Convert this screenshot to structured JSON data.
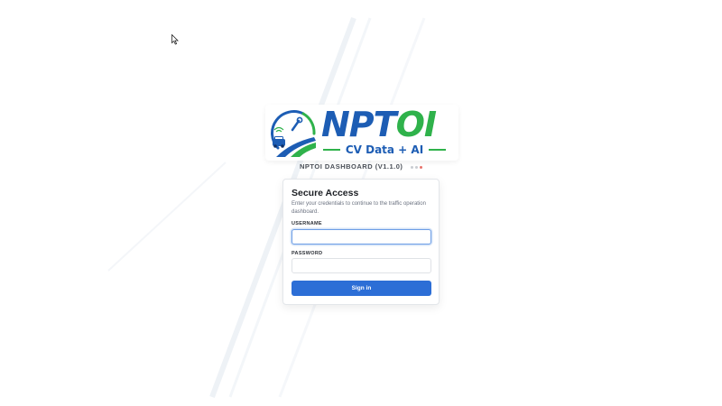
{
  "logo": {
    "name_part_a": "NPT",
    "name_part_b": "OI",
    "tagline": "CV Data + AI",
    "colors": {
      "blue": "#1d5db4",
      "green": "#2fb24b"
    }
  },
  "header": {
    "version_label": "NPTOI DASHBOARD (V1.1.0)",
    "status_dot_colors": [
      "#c9ccd1",
      "#c9ccd1",
      "#e8736b"
    ]
  },
  "login": {
    "title": "Secure Access",
    "subtitle": "Enter your credentials to continue to the traffic operation dashboard.",
    "username_label": "USERNAME",
    "username_value": "",
    "password_label": "PASSWORD",
    "password_value": "",
    "signin_label": "Sign in"
  },
  "colors": {
    "accent": "#2c6ed6",
    "focus_border": "#6d9ee6"
  }
}
